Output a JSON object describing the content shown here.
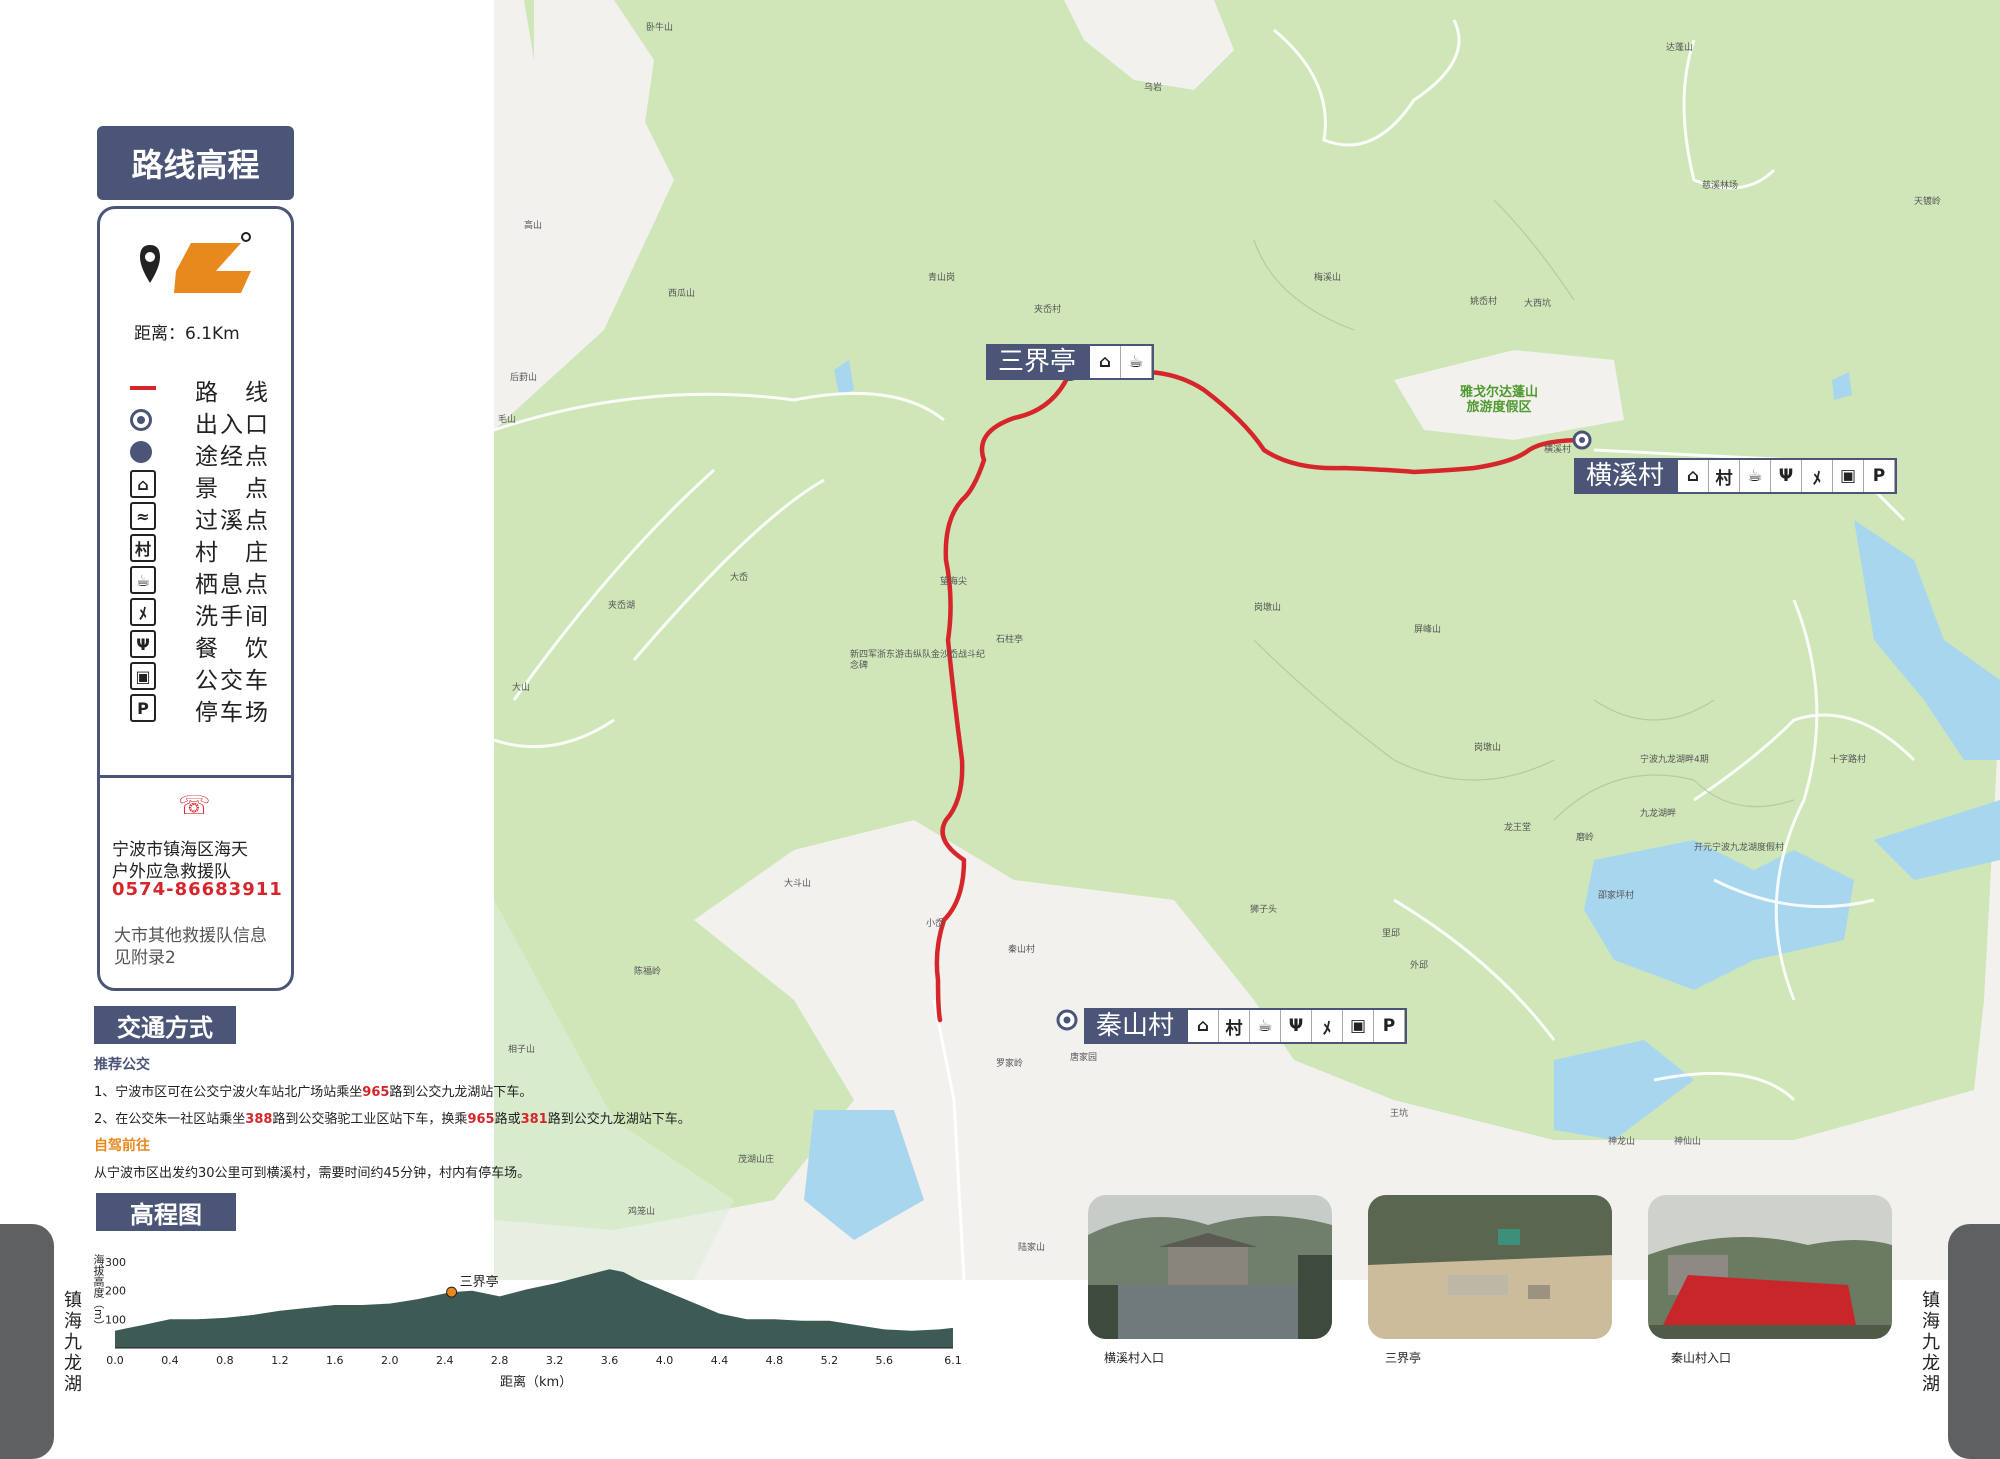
{
  "title": "路线高程",
  "distance_label": "距离：6.1Km",
  "legend": [
    {
      "icon": "route-line",
      "label": "路　线"
    },
    {
      "icon": "entrance-exit-point",
      "label": "出入口"
    },
    {
      "icon": "waypoint-dot",
      "label": "途经点"
    },
    {
      "icon": "scenic-spot-icon",
      "label": "景　点"
    },
    {
      "icon": "stream-crossing-icon",
      "label": "过溪点"
    },
    {
      "icon": "village-icon",
      "label": "村　庄"
    },
    {
      "icon": "rest-point-icon",
      "label": "栖息点"
    },
    {
      "icon": "restroom-icon",
      "label": "洗手间"
    },
    {
      "icon": "dining-icon",
      "label": "餐　饮"
    },
    {
      "icon": "bus-icon",
      "label": "公交车"
    },
    {
      "icon": "parking-icon",
      "label": "停车场"
    }
  ],
  "rescue": {
    "org_line1": "宁波市镇海区海天",
    "org_line2": "户外应急救援队",
    "phone": "0574-86683911",
    "note_line1": "大市其他救援队信息",
    "note_line2": "见附录2"
  },
  "transport": {
    "title": "交通方式",
    "bus_heading": "推荐公交",
    "bus1": {
      "a": "1、宁波市区可在公交宁波火车站北广场站乘坐",
      "n1": "965",
      "b": "路到公交九龙湖站下车。"
    },
    "bus2": {
      "a": "2、在公交朱一社区站乘坐",
      "n1": "388",
      "b": "路到公交骆驼工业区站下车，换乘",
      "n2": "965",
      "c": "路或",
      "n3": "381",
      "d": "路到公交九龙湖站下车。"
    },
    "drive_heading": "自驾前往",
    "drive_text": "从宁波市区出发约30公里可到横溪村，需要时间约45分钟，村内有停车场。"
  },
  "elevation": {
    "title": "高程图",
    "ylabel": "海拔高度（m）",
    "xlabel": "距离（km）",
    "y_ticks": [
      "300",
      "200",
      "100"
    ],
    "x_ticks": [
      "0.0",
      "0.4",
      "0.8",
      "1.2",
      "1.6",
      "2.0",
      "2.4",
      "2.8",
      "3.2",
      "3.6",
      "4.0",
      "4.4",
      "4.8",
      "5.2",
      "5.6",
      "6.1"
    ],
    "marker_label": "三界亭",
    "marker_km": 2.45
  },
  "chart_data": {
    "type": "area",
    "xlabel": "距离（km）",
    "ylabel": "海拔高度（m）",
    "ylim": [
      0,
      300
    ],
    "xlim": [
      0,
      6.1
    ],
    "x": [
      0.0,
      0.1,
      0.2,
      0.4,
      0.6,
      0.8,
      1.0,
      1.2,
      1.4,
      1.6,
      1.8,
      2.0,
      2.2,
      2.4,
      2.45,
      2.6,
      2.8,
      3.0,
      3.2,
      3.4,
      3.6,
      3.7,
      3.8,
      4.0,
      4.2,
      4.4,
      4.6,
      4.8,
      5.0,
      5.2,
      5.4,
      5.6,
      5.8,
      6.0,
      6.1
    ],
    "y": [
      60,
      70,
      80,
      100,
      100,
      105,
      115,
      130,
      140,
      150,
      150,
      155,
      170,
      190,
      195,
      200,
      180,
      205,
      225,
      250,
      275,
      265,
      240,
      200,
      160,
      120,
      100,
      100,
      95,
      95,
      80,
      65,
      60,
      65,
      70
    ],
    "annotations": [
      {
        "x": 2.45,
        "label": "三界亭"
      }
    ]
  },
  "map": {
    "pois": [
      {
        "name": "三界亭",
        "icons": [
          "scenic-spot-icon",
          "rest-point-icon"
        ]
      },
      {
        "name": "横溪村",
        "icons": [
          "scenic-spot-icon",
          "village-icon",
          "rest-point-icon",
          "dining-icon",
          "restroom-icon",
          "bus-icon",
          "parking-icon"
        ]
      },
      {
        "name": "秦山村",
        "icons": [
          "scenic-spot-icon",
          "village-icon",
          "rest-point-icon",
          "dining-icon",
          "restroom-icon",
          "bus-icon",
          "parking-icon"
        ]
      }
    ],
    "resort_label_1": "雅戈尔达蓬山",
    "resort_label_2": "旅游度假区",
    "small_labels": [
      "达蓬山",
      "慈溪林场",
      "天镀岭",
      "横溪村",
      "大西坑",
      "屏峰山",
      "岗墩山",
      "乃本山",
      "宁波九龙湖畔4期",
      "十字路村",
      "九龙湖畔",
      "开元宁波九龙湖度假村",
      "龙王堂",
      "磨岭",
      "邵家坪村",
      "神龙山",
      "狮子头",
      "里邱",
      "外邱",
      "王坑",
      "神仙山",
      "陆家山",
      "鸡笼山",
      "茂湖山庄",
      "大斗山",
      "陈福岭",
      "秦山村",
      "唐家园",
      "罗家岭",
      "相子山",
      "小岙",
      "大岙",
      "望海尖",
      "石柱亭",
      "新四军浙东游击纵队金沙岙战斗纪念碑",
      "西瓜山",
      "青山岗",
      "夹岙村",
      "乌岩",
      "梅溪山",
      "姚岙村",
      "高山",
      "后葑山",
      "毛山",
      "夹岙湖",
      "卧牛山",
      "大山"
    ]
  },
  "photos": [
    {
      "caption": "横溪村入口"
    },
    {
      "caption": "三界亭"
    },
    {
      "caption": "秦山村入口"
    }
  ],
  "side_left": "镇海九龙湖",
  "side_right": "镇海九龙湖",
  "colors": {
    "panel": "#4a5578",
    "route": "#d6262b",
    "accent_orange": "#e8891e",
    "map_green": "#cfe6b8",
    "water": "#a9d6ef"
  }
}
